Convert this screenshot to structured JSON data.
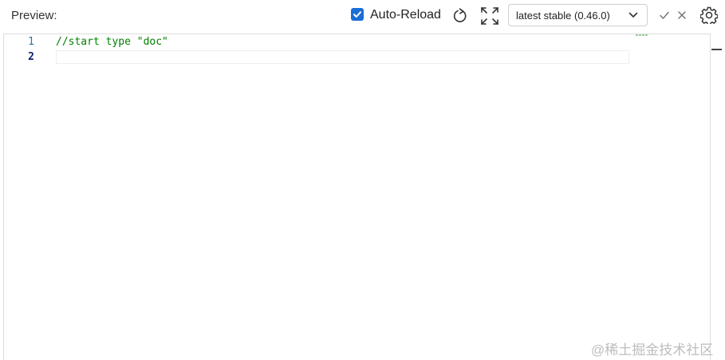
{
  "toolbar": {
    "preview_label": "Preview:",
    "auto_reload": {
      "label": "Auto-Reload",
      "checked": true
    },
    "version_select": {
      "value": "latest stable (0.46.0)"
    },
    "icons": [
      "refresh-icon",
      "expand-icon",
      "chevron-down-icon",
      "check-icon",
      "close-icon",
      "gear-icon"
    ],
    "accent_color": "#1a6fd6"
  },
  "editor": {
    "lines": [
      {
        "number": "1",
        "text": "//start type \"doc\""
      },
      {
        "number": "2",
        "text": ""
      }
    ],
    "comment_color": "#008000",
    "line_number_color": "#237893"
  },
  "watermark": "@稀土掘金技术社区"
}
